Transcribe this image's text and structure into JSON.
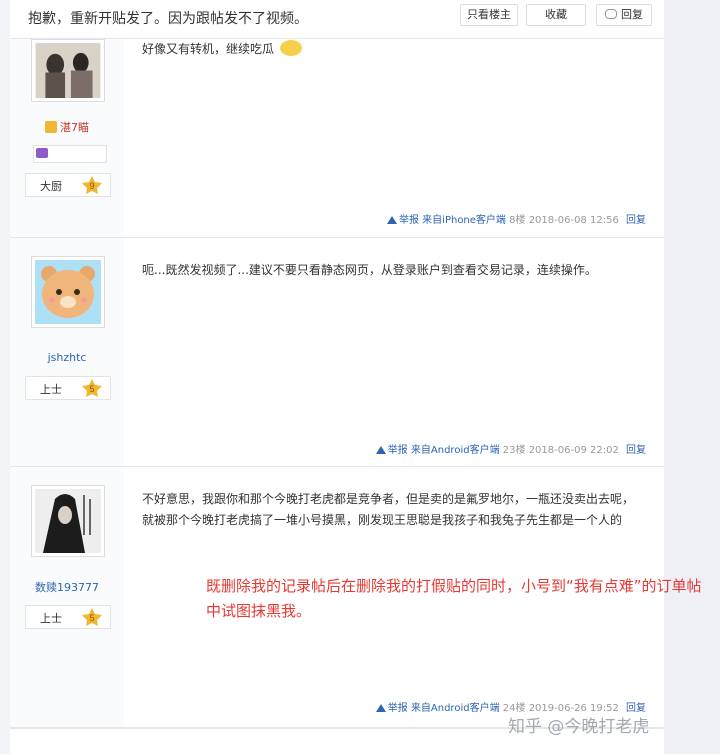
{
  "header": {
    "title": "抱歉，重新开贴发了。因为跟帖发不了视频。",
    "only_op_label": "只看楼主",
    "favorite_label": "收藏",
    "reply_label": "回复"
  },
  "posts": [
    {
      "username": "湛7瞄",
      "level_name": "大厨",
      "level_num": "9",
      "content": "好像又有转机，继续吃瓜",
      "report": "举报",
      "client": "来自iPhone客户端",
      "floor": "8楼",
      "time": "2018-06-08 12:56",
      "reply": "回复"
    },
    {
      "username": "jshzhtc",
      "level_name": "上士",
      "level_num": "5",
      "content": "呃...既然发视频了...建议不要只看静态网页，从登录账户到查看交易记录，连续操作。",
      "report": "举报",
      "client": "来自Android客户端",
      "floor": "23楼",
      "time": "2018-06-09 22:02",
      "reply": "回复"
    },
    {
      "username": "数赎193777",
      "level_name": "上士",
      "level_num": "5",
      "content": "不好意思，我跟你和那个今晚打老虎都是竞争者，但是卖的是氟罗地尔，一瓶还没卖出去呢，就被那个今晚打老虎搞了一堆小号摸黑，刚发现王思聪是我孩子和我兔子先生都是一个人的",
      "report": "举报",
      "client": "来自Android客户端",
      "floor": "24楼",
      "time": "2019-06-26 19:52",
      "reply": "回复"
    }
  ],
  "annotation": "既删除我的记录帖后在删除我的打假贴的同时，小号到“我有点难”的订单帖中试图抹黑我。",
  "watermark": "知乎 @今晚打老虎",
  "colors": {
    "link": "#2d64b3",
    "annotation": "#e53935",
    "badge": "#f2b632"
  }
}
